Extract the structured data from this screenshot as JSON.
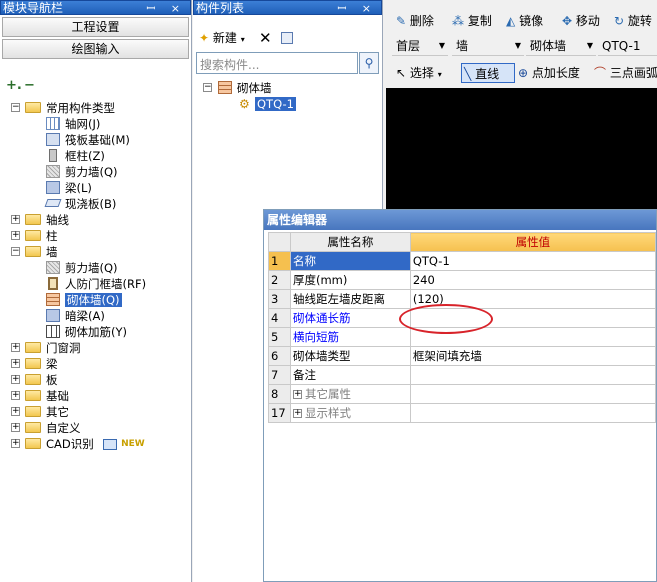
{
  "nav": {
    "title": "模块导航栏",
    "btn_engineering": "工程设置",
    "btn_drawing": "绘图输入",
    "tree": [
      {
        "label": "常用构件类型"
      },
      {
        "label": "轴网(J)"
      },
      {
        "label": "筏板基础(M)"
      },
      {
        "label": "框柱(Z)"
      },
      {
        "label": "剪力墙(Q)"
      },
      {
        "label": "梁(L)"
      },
      {
        "label": "现浇板(B)"
      },
      {
        "label": "轴线"
      },
      {
        "label": "柱"
      },
      {
        "label": "墙"
      },
      {
        "label": "剪力墙(Q)"
      },
      {
        "label": "人防门框墙(RF)"
      },
      {
        "label": "砌体墙(Q)"
      },
      {
        "label": "暗梁(A)"
      },
      {
        "label": "砌体加筋(Y)"
      },
      {
        "label": "门窗洞"
      },
      {
        "label": "梁"
      },
      {
        "label": "板"
      },
      {
        "label": "基础"
      },
      {
        "label": "其它"
      },
      {
        "label": "自定义"
      },
      {
        "label": "CAD识别"
      }
    ],
    "new_badge": "NEW"
  },
  "comp": {
    "title": "构件列表",
    "new_label": "新建",
    "search_placeholder": "搜索构件...",
    "root": "砌体墙",
    "child": "QTQ-1"
  },
  "toolbar": {
    "delete": "删除",
    "copy": "复制",
    "mirror": "镜像",
    "move": "移动",
    "rotate": "旋转",
    "floor": "首层",
    "type": "墙",
    "subtype": "砌体墙",
    "element": "QTQ-1",
    "select": "选择",
    "line": "直线",
    "point_length": "点加长度",
    "arc": "三点画弧"
  },
  "prop": {
    "title": "属性编辑器",
    "col_name": "属性名称",
    "col_value": "属性值",
    "rows": [
      {
        "num": "1",
        "name": "名称",
        "value": "QTQ-1"
      },
      {
        "num": "2",
        "name": "厚度(mm)",
        "value": "240"
      },
      {
        "num": "3",
        "name": "轴线距左墙皮距离",
        "value": "(120)"
      },
      {
        "num": "4",
        "name": "砌体通长筋",
        "value": ""
      },
      {
        "num": "5",
        "name": "横向短筋",
        "value": ""
      },
      {
        "num": "6",
        "name": "砌体墙类型",
        "value": "框架间填充墙"
      },
      {
        "num": "7",
        "name": "备注",
        "value": ""
      },
      {
        "num": "8",
        "name": "其它属性",
        "value": ""
      },
      {
        "num": "17",
        "name": "显示样式",
        "value": ""
      }
    ]
  },
  "colors": {
    "selection": "#3169c6",
    "header_blue": "#1f5fb8",
    "value_header": "#f5c04f",
    "annotation": "#d8232a"
  }
}
